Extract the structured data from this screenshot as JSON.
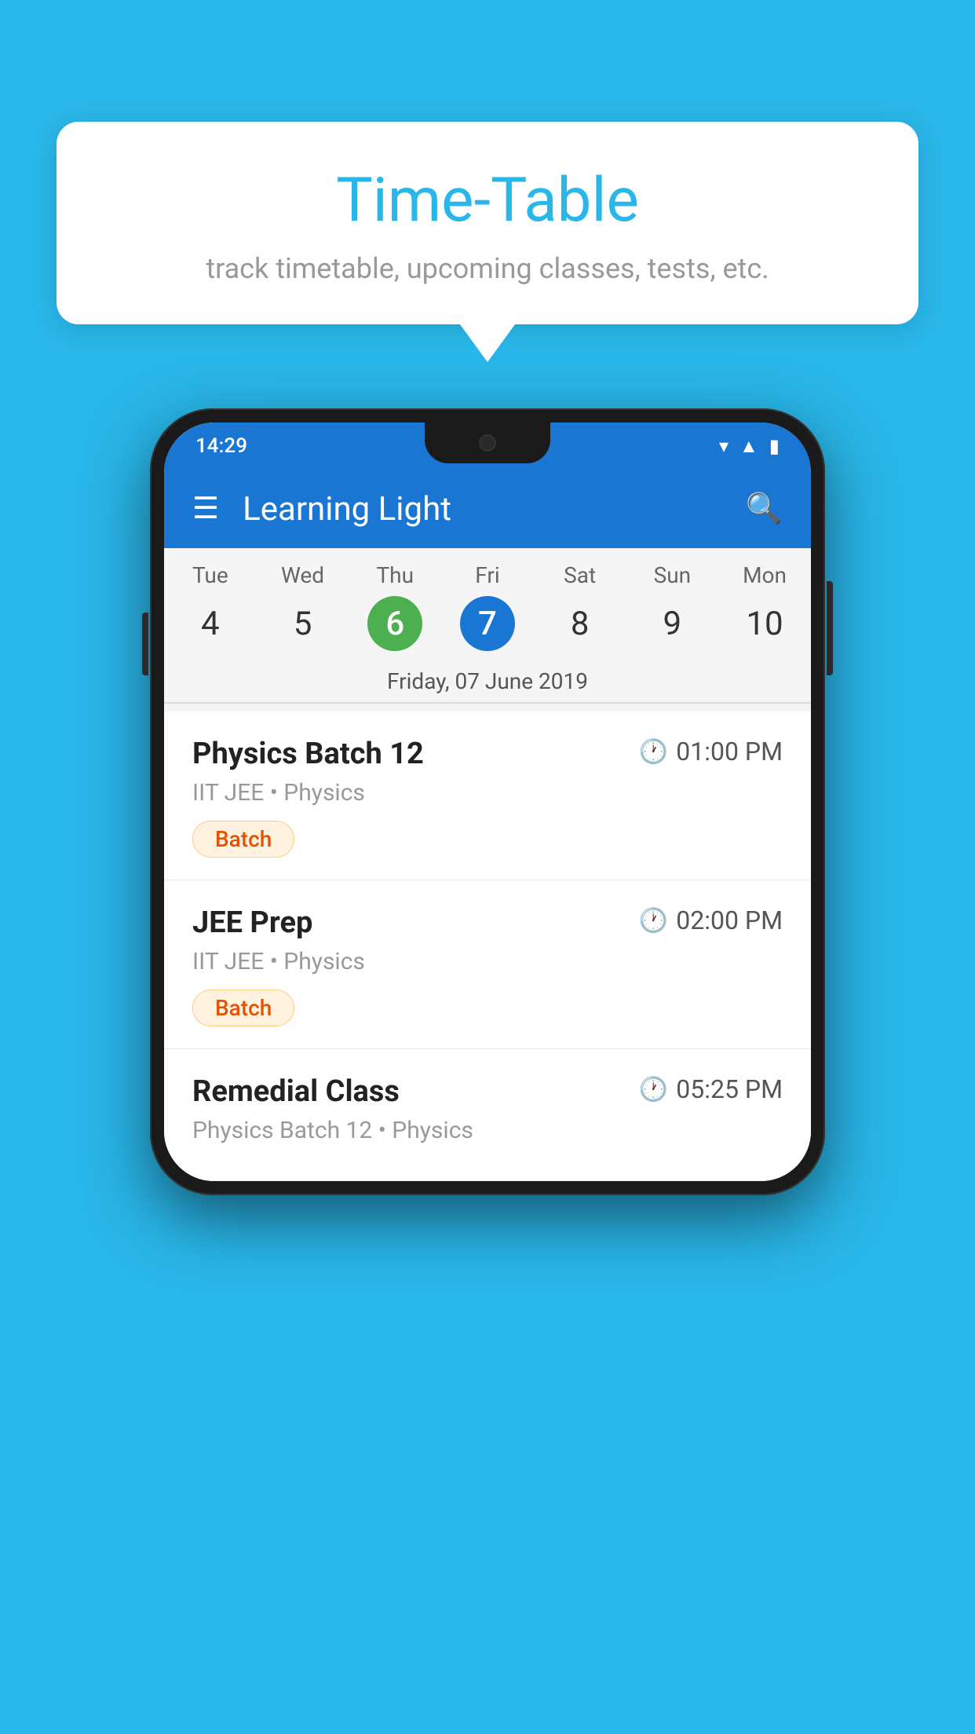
{
  "background_color": "#29B6E8",
  "speech_bubble": {
    "title": "Time-Table",
    "subtitle": "track timetable, upcoming classes, tests, etc."
  },
  "status_bar": {
    "time": "14:29"
  },
  "app_bar": {
    "title": "Learning Light"
  },
  "calendar": {
    "days": [
      {
        "name": "Tue",
        "number": "4",
        "state": "normal"
      },
      {
        "name": "Wed",
        "number": "5",
        "state": "normal"
      },
      {
        "name": "Thu",
        "number": "6",
        "state": "today"
      },
      {
        "name": "Fri",
        "number": "7",
        "state": "selected"
      },
      {
        "name": "Sat",
        "number": "8",
        "state": "normal"
      },
      {
        "name": "Sun",
        "number": "9",
        "state": "normal"
      },
      {
        "name": "Mon",
        "number": "10",
        "state": "normal"
      }
    ],
    "selected_date_label": "Friday, 07 June 2019"
  },
  "schedule_items": [
    {
      "title": "Physics Batch 12",
      "time": "01:00 PM",
      "subtitle": "IIT JEE • Physics",
      "tag": "Batch"
    },
    {
      "title": "JEE Prep",
      "time": "02:00 PM",
      "subtitle": "IIT JEE • Physics",
      "tag": "Batch"
    },
    {
      "title": "Remedial Class",
      "time": "05:25 PM",
      "subtitle": "Physics Batch 12 • Physics",
      "tag": ""
    }
  ]
}
